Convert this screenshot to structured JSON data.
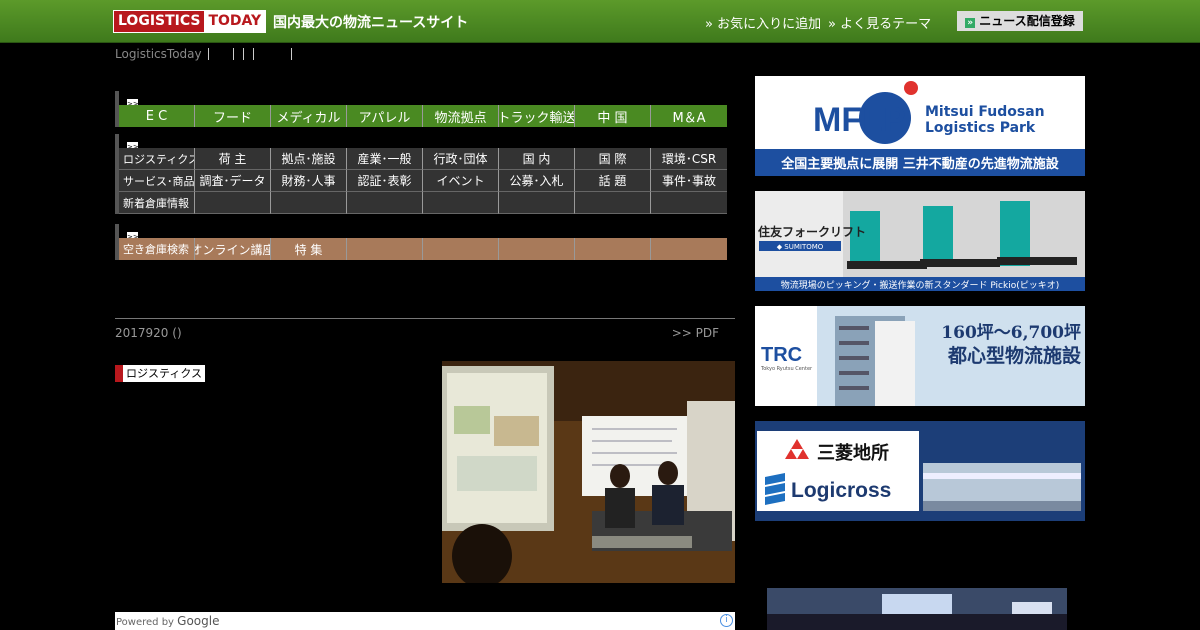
{
  "header": {
    "logo_left": "LOGISTICS",
    "logo_right": "TODAY",
    "tagline": "国内最大の物流ニュースサイト",
    "favorite": "» お気に入りに追加",
    "themes": "» よく見るテーマ",
    "register": "ニュース配信登録",
    "register_icon": "»"
  },
  "breadcrumb": {
    "home": "LogisticsToday"
  },
  "nav_marker": ">>",
  "nav_industry": [
    "E C",
    "フード",
    "メディカル",
    "アパレル",
    "物流拠点",
    "トラック輸送",
    "中 国",
    "M＆A"
  ],
  "nav_topics": [
    [
      "ロジスティクス",
      "荷 主",
      "拠点･施設",
      "産業･一般",
      "行政･団体",
      "国 内",
      "国 際",
      "環境･CSR"
    ],
    [
      "サービス･商品",
      "調査･データ",
      "財務･人事",
      "認証･表彰",
      "イベント",
      "公募･入札",
      "話 題",
      "事件･事故"
    ],
    [
      "新着倉庫情報",
      "",
      "",
      "",
      "",
      "",
      "",
      ""
    ]
  ],
  "nav_services": [
    "空き倉庫検索",
    "オンライン講座",
    "特 集",
    "",
    "",
    "",
    "",
    ""
  ],
  "article": {
    "date": "2017920 ()",
    "pdf": ">> PDF",
    "category": "ロジスティクス"
  },
  "google_bar": {
    "powered": "Powered by",
    "google": "Google",
    "ad_icon": "i"
  },
  "ads": {
    "mflp": {
      "logo": "MFLP",
      "name1": "Mitsui Fudosan",
      "name2": "Logistics Park",
      "caption": "全国主要拠点に展開 三井不動産の先進物流施設"
    },
    "sumitomo": {
      "brand": "住友フォークリフト",
      "sub": "◆ SUMITOMO",
      "caption": "物流現場のピッキング・搬送作業の新スタンダード Pickio(ピッキオ)"
    },
    "trc": {
      "logo": "TRC",
      "sub": "Tokyo Ryutsu Center",
      "line1": "160坪～6,700坪",
      "line2": "都心型物流施設"
    },
    "mitsubishi": {
      "name": "三菱地所",
      "brand": "Logicross"
    }
  },
  "colors": {
    "header_green": "#4a8a22",
    "logo_red": "#b8181d",
    "service_brown": "#a87a5a"
  }
}
